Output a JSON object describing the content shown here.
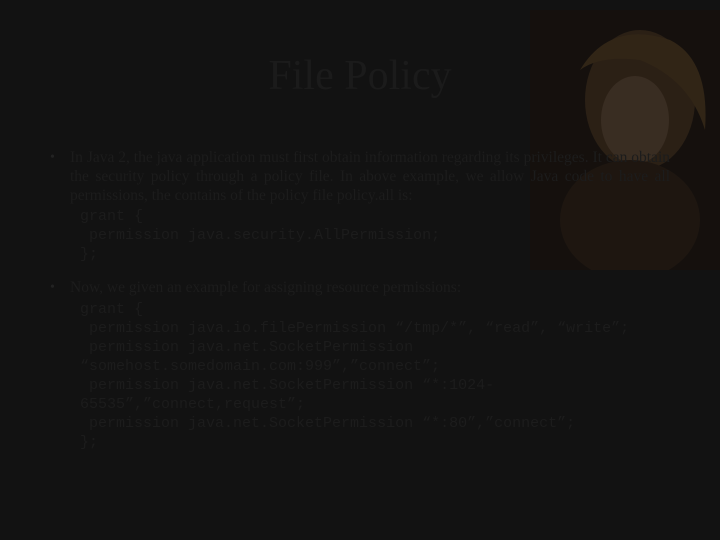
{
  "title": "File Policy",
  "bullets": [
    {
      "text": "In Java 2, the java application must first obtain information regarding its privileges. It can obtain the security policy through a policy file. In above example, we allow Java code to have all permissions,  the contains of the policy file policy.all is:",
      "code": "grant {\n permission java.security.AllPermission;\n};"
    },
    {
      "text": "Now, we given an example for assigning resource permissions:",
      "code": "grant {\n permission java.io.filePermission “/tmp/*”, “read”, “write”;\n permission java.net.SocketPermission “somehost.somedomain.com:999”,”connect”;\n permission java.net.SocketPermission “*:1024-65535”,”connect,request”;\n permission java.net.SocketPermission “*:80”,”connect”;\n};"
    }
  ]
}
